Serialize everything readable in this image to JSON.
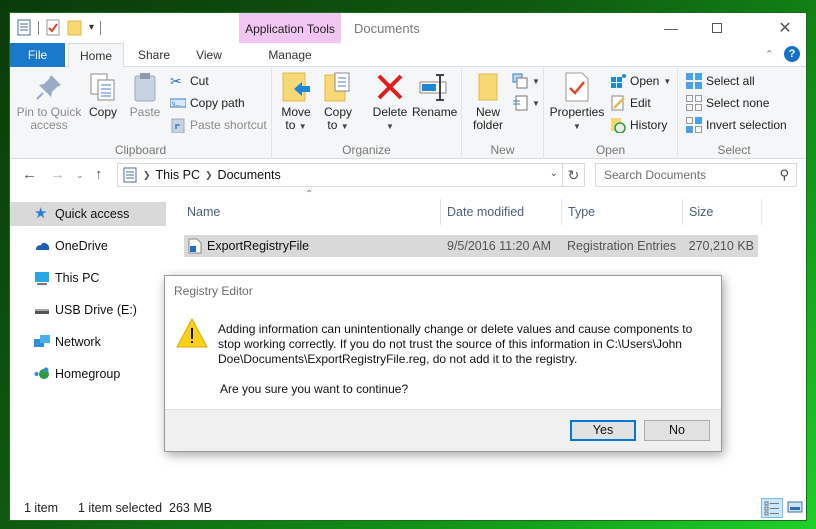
{
  "window": {
    "title": "Documents",
    "contextual_tab": "Application Tools",
    "controls": [
      "minimize",
      "maximize",
      "close"
    ]
  },
  "ribbon_tabs": [
    {
      "label": "File"
    },
    {
      "label": "Home",
      "active": true
    },
    {
      "label": "Share"
    },
    {
      "label": "View"
    },
    {
      "label": "Manage"
    }
  ],
  "ribbon": {
    "clipboard": {
      "label": "Clipboard",
      "pin": "Pin to Quick access",
      "pin_l1": "Pin to Quick",
      "pin_l2": "access",
      "copy": "Copy",
      "paste": "Paste",
      "cut": "Cut",
      "copy_path": "Copy path",
      "paste_shortcut": "Paste shortcut"
    },
    "organize": {
      "label": "Organize",
      "move_l1": "Move",
      "move_l2": "to",
      "copy_l1": "Copy",
      "copy_l2": "to",
      "delete": "Delete",
      "rename": "Rename"
    },
    "new": {
      "label": "New",
      "folder_l1": "New",
      "folder_l2": "folder"
    },
    "open": {
      "label": "Open",
      "properties": "Properties",
      "open": "Open",
      "edit": "Edit",
      "history": "History"
    },
    "select": {
      "label": "Select",
      "select_all": "Select all",
      "select_none": "Select none",
      "invert": "Invert selection"
    }
  },
  "address": {
    "crumbs": [
      "This PC",
      "Documents"
    ],
    "search_placeholder": "Search Documents"
  },
  "nav_pane": [
    {
      "label": "Quick access",
      "icon": "star-icon",
      "selected": true
    },
    {
      "label": "OneDrive",
      "icon": "cloud-icon"
    },
    {
      "label": "This PC",
      "icon": "monitor-icon"
    },
    {
      "label": "USB Drive (E:)",
      "icon": "drive-icon"
    },
    {
      "label": "Network",
      "icon": "network-icon"
    },
    {
      "label": "Homegroup",
      "icon": "homegroup-icon"
    }
  ],
  "columns": [
    "Name",
    "Date modified",
    "Type",
    "Size"
  ],
  "files": [
    {
      "name": "ExportRegistryFile",
      "date": "9/5/2016 11:20 AM",
      "type": "Registration Entries",
      "size": "270,210 KB"
    }
  ],
  "status": {
    "items": "1 item",
    "selected": "1 item selected  263 MB"
  },
  "dialog": {
    "title": "Registry Editor",
    "message": "Adding information can unintentionally change or delete values and cause components to stop working correctly. If you do not trust the source of this information in C:\\Users\\John Doe\\Documents\\ExportRegistryFile.reg, do not add it to the registry.",
    "question": "Are you sure you want to continue?",
    "yes": "Yes",
    "no": "No"
  },
  "colors": {
    "file_tab": "#1979ca",
    "context_tab": "#f2c6f2",
    "selection": "#d9d9d9",
    "default_button_border": "#0078d7"
  }
}
